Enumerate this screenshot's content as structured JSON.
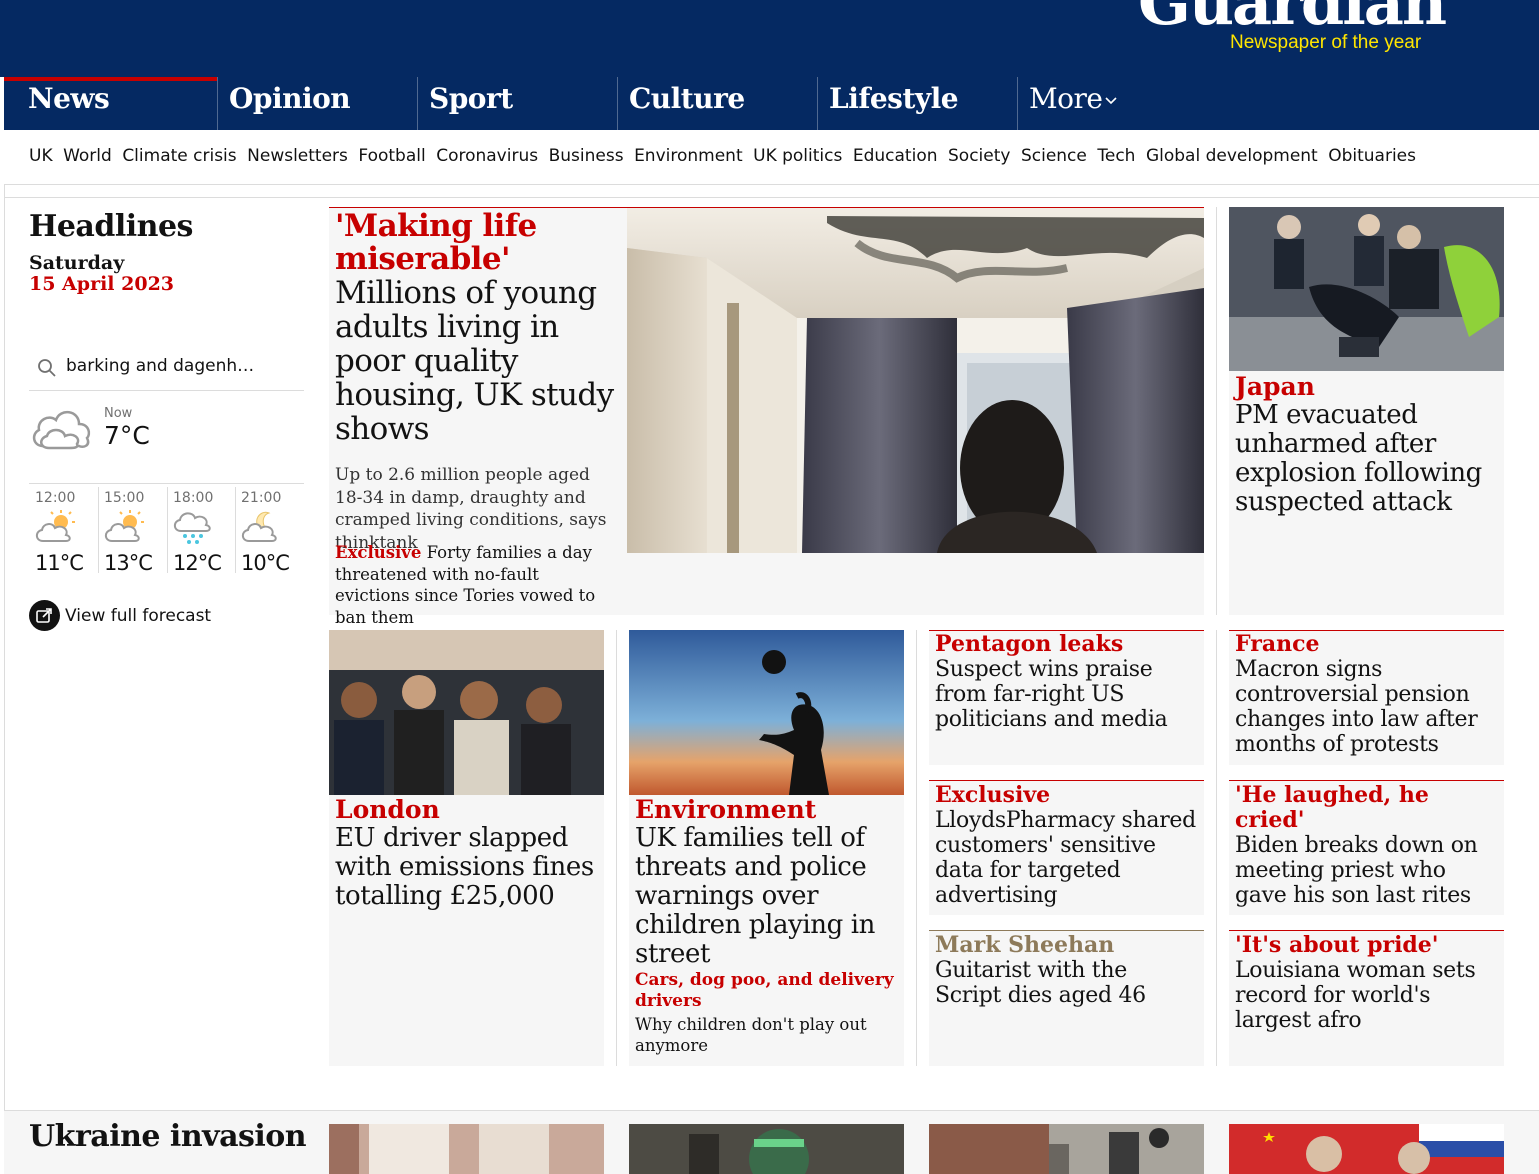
{
  "masthead": {
    "logo_text": "Guardian",
    "tagline": "Newspaper of the year"
  },
  "pillars": [
    {
      "label": "News",
      "active": true
    },
    {
      "label": "Opinion"
    },
    {
      "label": "Sport"
    },
    {
      "label": "Culture"
    },
    {
      "label": "Lifestyle"
    },
    {
      "label": "More"
    }
  ],
  "subnav": [
    "UK",
    "World",
    "Climate crisis",
    "Newsletters",
    "Football",
    "Coronavirus",
    "Business",
    "Environment",
    "UK politics",
    "Education",
    "Society",
    "Science",
    "Tech",
    "Global development",
    "Obituaries"
  ],
  "left": {
    "title": "Headlines",
    "day": "Saturday",
    "date": "15 April 2023",
    "search_value": "barking and dagenh…",
    "now_label": "Now",
    "now_temp": "7°C",
    "forecast": [
      {
        "time": "12:00",
        "temp": "11°C",
        "icon": "sun-cloud-icon"
      },
      {
        "time": "15:00",
        "temp": "13°C",
        "icon": "sun-cloud-icon"
      },
      {
        "time": "18:00",
        "temp": "12°C",
        "icon": "rain-cloud-icon"
      },
      {
        "time": "21:00",
        "temp": "10°C",
        "icon": "moon-cloud-icon"
      }
    ],
    "view_forecast": "View full forecast"
  },
  "main_story": {
    "kicker": "'Making life miserable'",
    "headline": "Millions of young adults living in poor quality housing, UK study shows",
    "standfirst": "Up to 2.6 million people aged 18-34 in damp, draughty and cramped living conditions, says thinktank",
    "sub_kicker": "Exclusive",
    "sub_headline": "Forty families a day threatened with no-fault evictions since Tories vowed to ban them"
  },
  "japan": {
    "kicker": "Japan",
    "headline": "PM evacuated unharmed after explosion following suspected attack"
  },
  "london": {
    "kicker": "London",
    "headline": "EU driver slapped with emissions fines totalling £25,000"
  },
  "environment": {
    "kicker": "Environment",
    "headline": "UK families tell of threats and police warnings over children playing in street",
    "sub_kicker": "Cars, dog poo, and delivery drivers",
    "sub_headline": "Why children don't play out anymore"
  },
  "small_cards": [
    {
      "kicker": "Pentagon leaks",
      "headline": "Suspect wins praise from far-right US politicians and media"
    },
    {
      "kicker": "France",
      "headline": "Macron signs controversial pension changes into law after months of protests"
    },
    {
      "kicker": "Exclusive",
      "headline": "LloydsPharmacy shared customers' sensitive data for targeted advertising"
    },
    {
      "kicker": "'He laughed, he cried'",
      "headline": "Biden breaks down on meeting priest who gave his son last rites"
    },
    {
      "kicker": "Mark Sheehan",
      "headline": "Guitarist with the Script dies aged 46"
    },
    {
      "kicker": "'It's about pride'",
      "headline": "Louisiana woman sets record for world's largest afro"
    }
  ],
  "next_section": {
    "title": "Ukraine invasion"
  },
  "colors": {
    "brand": "#052962",
    "accent": "#c70000",
    "tagline": "#ffe500",
    "card_bg": "#f6f6f6"
  }
}
